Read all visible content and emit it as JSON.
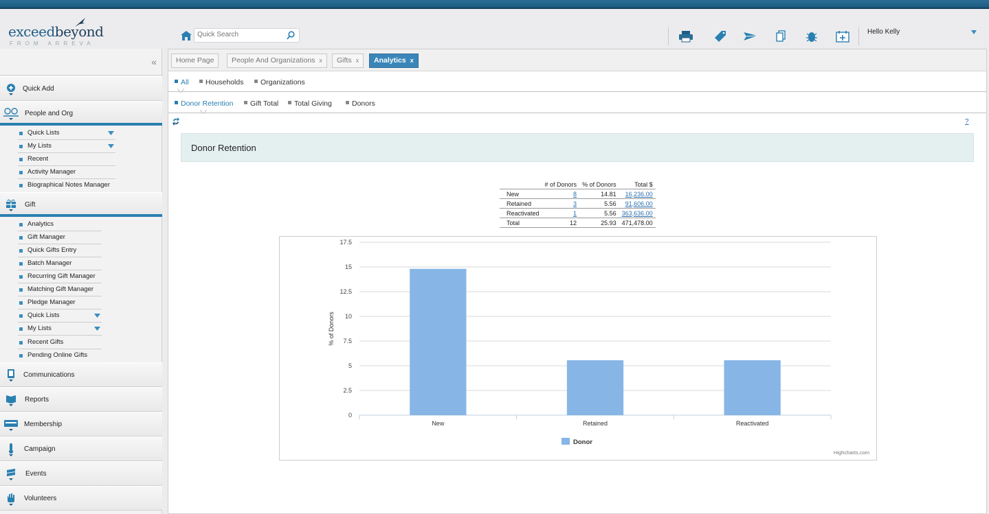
{
  "header": {
    "logo_word": "exceed",
    "logo_word2": "beyond",
    "logo_sub": "FROM ARREVA",
    "search_placeholder": "Quick Search",
    "greeting": "Hello Kelly"
  },
  "sidebar": {
    "collapse_glyph": "«",
    "sections": {
      "quick_add": "Quick Add",
      "people": "People and Org",
      "gift": "Gift",
      "communications": "Communications",
      "reports": "Reports",
      "membership": "Membership",
      "campaign": "Campaign",
      "events": "Events",
      "volunteers": "Volunteers"
    },
    "people_items": [
      "Quick Lists",
      "My Lists",
      "Recent",
      "Activity Manager",
      "Biographical Notes Manager"
    ],
    "gift_items": [
      "Analytics",
      "Gift Manager",
      "Quick Gifts Entry",
      "Batch Manager",
      "Recurring Gift Manager",
      "Matching Gift Manager",
      "Pledge Manager",
      "Quick Lists",
      "My Lists",
      "Recent Gifts",
      "Pending Online Gifts"
    ]
  },
  "tabs": [
    "Home Page",
    "People And Organizations",
    "Gifts",
    "Analytics"
  ],
  "tab_close": "x",
  "subnav1": [
    "All",
    "Households",
    "Organizations"
  ],
  "subnav2": [
    "Donor Retention",
    "Gift Total",
    "Total Giving",
    "Donors"
  ],
  "help": "?",
  "panel_title": "Donor Retention",
  "stats": {
    "headers": [
      "# of Donors",
      "% of Donors",
      "Total $"
    ],
    "rows": [
      [
        "New",
        "8",
        "14.81",
        "16,236.00"
      ],
      [
        "Retained",
        "3",
        "5.56",
        "91,606.00"
      ],
      [
        "Reactivated",
        "1",
        "5.56",
        "363,636.00"
      ],
      [
        "Total",
        "12",
        "25.93",
        "471,478.00"
      ]
    ]
  },
  "chart_data": {
    "type": "bar",
    "categories": [
      "New",
      "Retained",
      "Reactivated"
    ],
    "series": [
      {
        "name": "Donor",
        "values": [
          14.81,
          5.56,
          5.56
        ]
      }
    ],
    "ylabel": "% of Donors",
    "ylim": [
      0,
      17.5
    ],
    "yticks": [
      "0",
      "2.5",
      "5",
      "7.5",
      "10",
      "12.5",
      "15",
      "17.5"
    ],
    "ytick_values": [
      0,
      2.5,
      5,
      7.5,
      10,
      12.5,
      15,
      17.5
    ],
    "grid": true,
    "legend": "bottom-center",
    "credit": "Highcharts.com",
    "bar_color": "#87b6e6"
  }
}
